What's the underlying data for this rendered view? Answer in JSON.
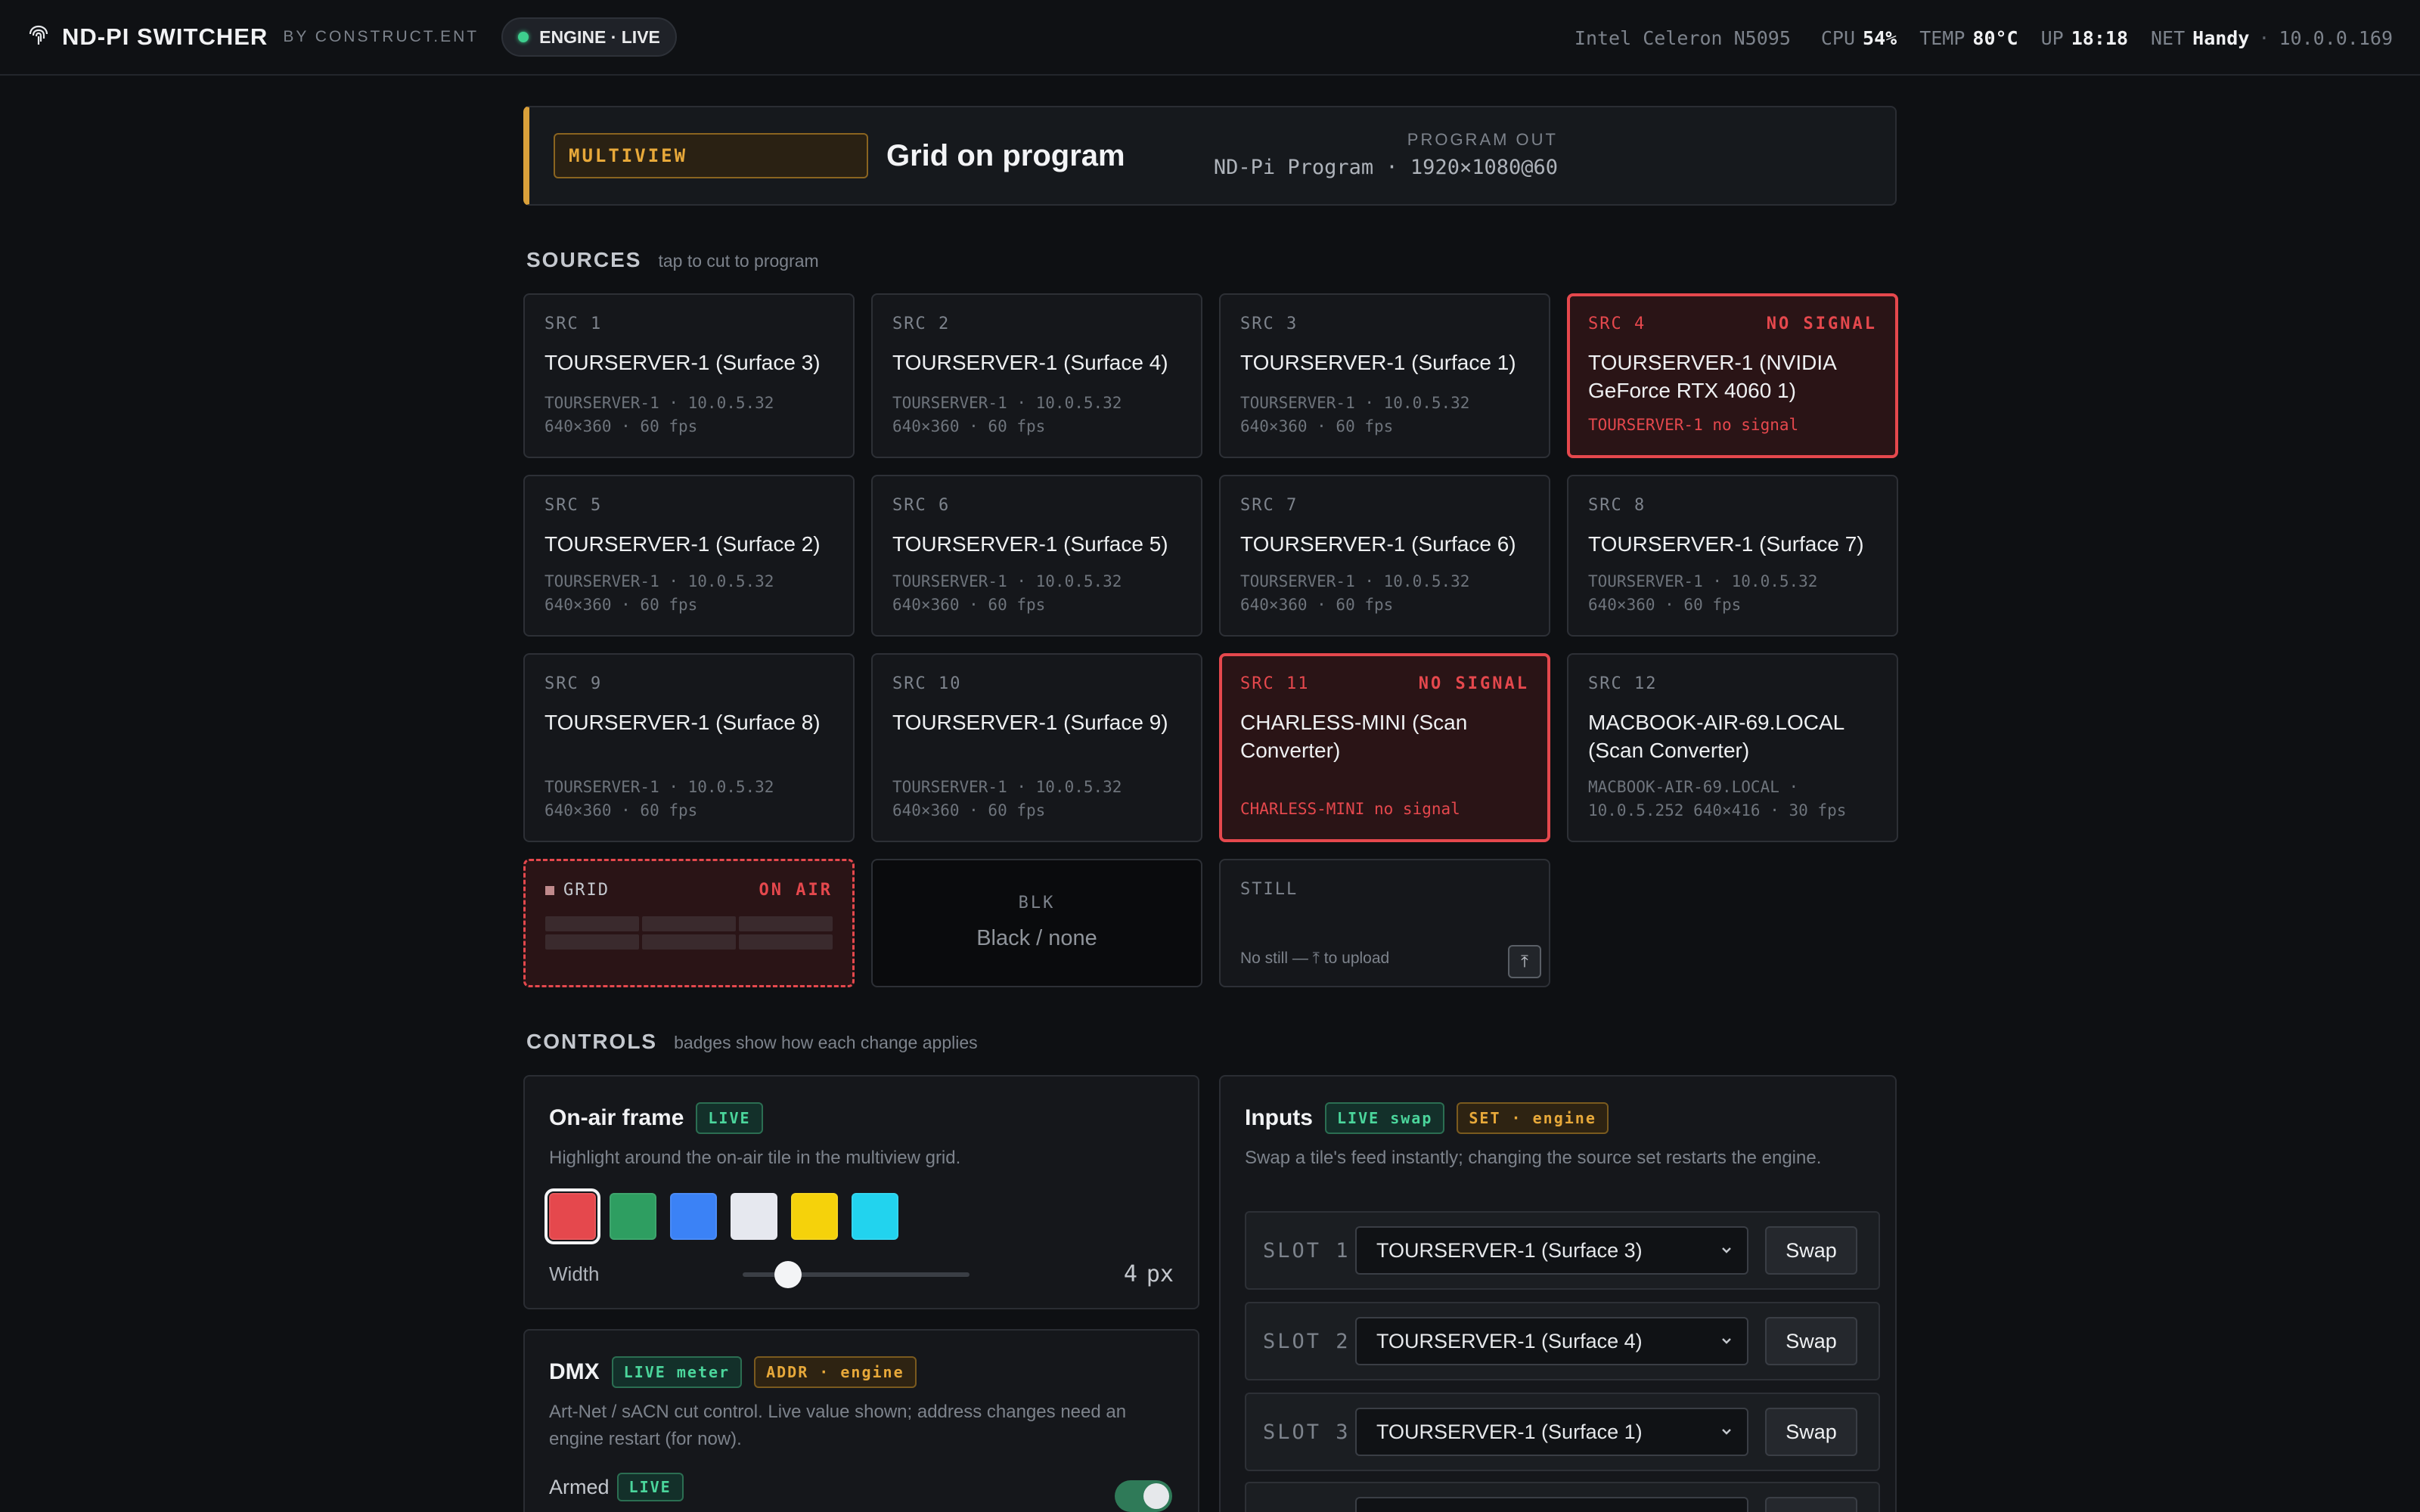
{
  "header": {
    "app_title": "ND-PI SWITCHER",
    "by_line": "BY CONSTRUCT.ENT",
    "engine_status": "ENGINE · LIVE",
    "cpu_model": "Intel Celeron N5095",
    "cpu_label": "CPU",
    "cpu_value": "54%",
    "temp_label": "TEMP",
    "temp_value": "80°C",
    "uptime_label": "UP",
    "uptime_value": "18:18",
    "net_label": "NET",
    "net_name": "Handy",
    "net_sep": "·",
    "net_ip": "10.0.0.169"
  },
  "banner": {
    "mode": "MULTIVIEW",
    "title": "Grid on program",
    "program_out_label": "PROGRAM OUT",
    "program_out_value": "ND-Pi Program · 1920×1080@60"
  },
  "sources_section": {
    "title": "SOURCES",
    "hint": "tap to cut to program"
  },
  "sources": [
    {
      "id": "SRC 1",
      "name": "TOURSERVER-1 (Surface 3)",
      "meta1": "TOURSERVER-1 · 10.0.5.32",
      "meta2": "640×360 · 60 fps",
      "status": ""
    },
    {
      "id": "SRC 2",
      "name": "TOURSERVER-1 (Surface 4)",
      "meta1": "TOURSERVER-1 · 10.0.5.32",
      "meta2": "640×360 · 60 fps",
      "status": ""
    },
    {
      "id": "SRC 3",
      "name": "TOURSERVER-1 (Surface 1)",
      "meta1": "TOURSERVER-1 · 10.0.5.32",
      "meta2": "640×360 · 60 fps",
      "status": ""
    },
    {
      "id": "SRC 4",
      "name": "TOURSERVER-1 (NVIDIA GeForce RTX 4060 1)",
      "meta1": "TOURSERVER-1 no signal",
      "meta2": "",
      "status": "NO SIGNAL"
    },
    {
      "id": "SRC 5",
      "name": "TOURSERVER-1 (Surface 2)",
      "meta1": "TOURSERVER-1 · 10.0.5.32",
      "meta2": "640×360 · 60 fps",
      "status": ""
    },
    {
      "id": "SRC 6",
      "name": "TOURSERVER-1 (Surface 5)",
      "meta1": "TOURSERVER-1 · 10.0.5.32",
      "meta2": "640×360 · 60 fps",
      "status": ""
    },
    {
      "id": "SRC 7",
      "name": "TOURSERVER-1 (Surface 6)",
      "meta1": "TOURSERVER-1 · 10.0.5.32",
      "meta2": "640×360 · 60 fps",
      "status": ""
    },
    {
      "id": "SRC 8",
      "name": "TOURSERVER-1 (Surface 7)",
      "meta1": "TOURSERVER-1 · 10.0.5.32",
      "meta2": "640×360 · 60 fps",
      "status": ""
    },
    {
      "id": "SRC 9",
      "name": "TOURSERVER-1 (Surface 8)",
      "meta1": "TOURSERVER-1 · 10.0.5.32",
      "meta2": "640×360 · 60 fps",
      "status": ""
    },
    {
      "id": "SRC 10",
      "name": "TOURSERVER-1 (Surface 9)",
      "meta1": "TOURSERVER-1 · 10.0.5.32",
      "meta2": "640×360 · 60 fps",
      "status": ""
    },
    {
      "id": "SRC 11",
      "name": "CHARLESS-MINI (Scan Converter)",
      "meta1": "CHARLESS-MINI no signal",
      "meta2": "",
      "status": "NO SIGNAL"
    },
    {
      "id": "SRC 12",
      "name": "MACBOOK-AIR-69.LOCAL (Scan Converter)",
      "meta1": "MACBOOK-AIR-69.LOCAL ·",
      "meta2": "10.0.5.252 640×416 · 30 fps",
      "status": ""
    }
  ],
  "special_tiles": {
    "grid_label": "GRID",
    "grid_badge": "ON AIR",
    "blk_label": "BLK",
    "blk_name": "Black / none",
    "still_label": "STILL",
    "still_hint": "No still — ⤒ to upload",
    "upload_glyph": "⤒"
  },
  "controls_section": {
    "title": "CONTROLS",
    "hint": "badges show how each change applies"
  },
  "onair_frame": {
    "title": "On-air frame",
    "badge": "LIVE",
    "desc": "Highlight around the on-air tile in the multiview grid.",
    "colors": [
      "#e5484d",
      "#2e9e61",
      "#3b82f6",
      "#e6e8ef",
      "#f5d20b",
      "#22d3ee"
    ],
    "selected_color": "#e5484d",
    "width_label": "Width",
    "width_value": "4",
    "width_unit": "px",
    "width_fraction": 0.2
  },
  "dmx": {
    "title": "DMX",
    "badge_live": "LIVE meter",
    "badge_engine": "ADDR · engine",
    "desc": "Art-Net / sACN cut control. Live value shown; address changes need an engine restart (for now).",
    "armed_label": "Armed",
    "armed_badge": "LIVE",
    "armed_on": true
  },
  "inputs": {
    "title": "Inputs",
    "badge_live": "LIVE swap",
    "badge_engine": "SET · engine",
    "desc": "Swap a tile's feed instantly; changing the source set restarts the engine.",
    "slots": [
      {
        "label": "SLOT 1",
        "value": "TOURSERVER-1 (Surface 3)",
        "button": "Swap"
      },
      {
        "label": "SLOT 2",
        "value": "TOURSERVER-1 (Surface 4)",
        "button": "Swap"
      },
      {
        "label": "SLOT 3",
        "value": "TOURSERVER-1 (Surface 1)",
        "button": "Swap"
      }
    ]
  },
  "colors": {
    "accent_amber": "#d9a03a",
    "live_green": "#4bd69c",
    "alert_red": "#e5484d"
  }
}
